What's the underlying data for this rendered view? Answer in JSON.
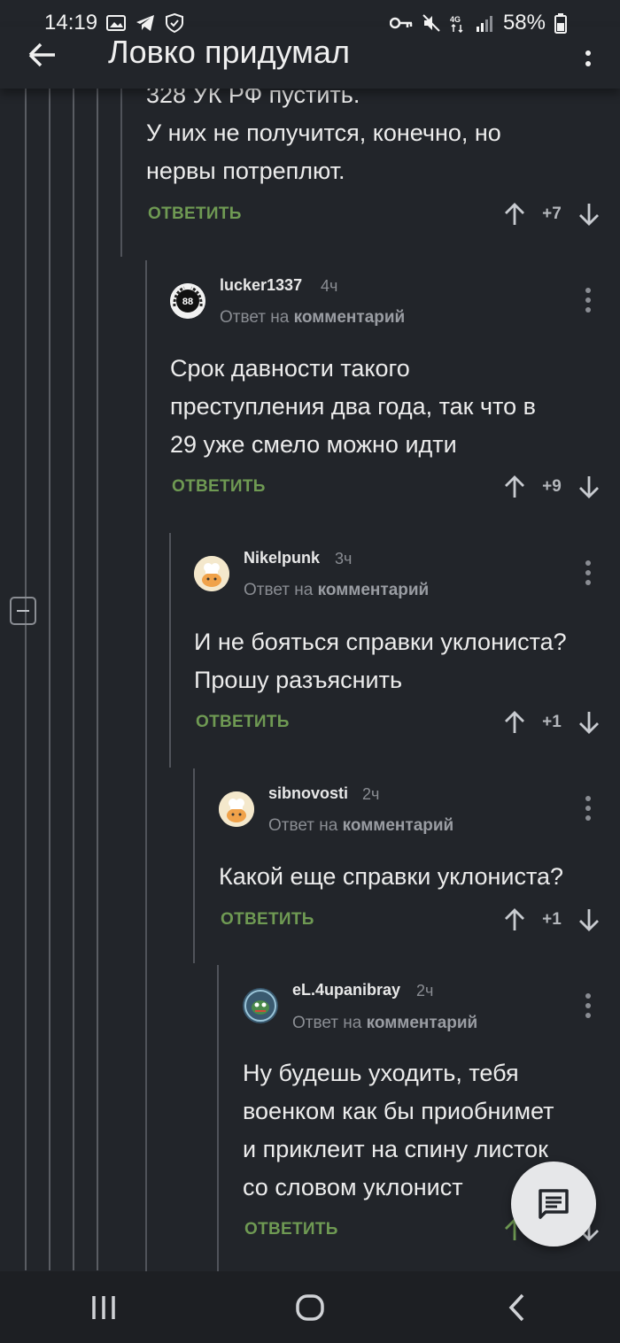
{
  "status_bar": {
    "time": "14:19",
    "battery": "58%",
    "icons_left": [
      "gallery-icon",
      "telegram-icon",
      "vpn-shield-icon"
    ],
    "icons_right": [
      "key-icon",
      "mute-icon",
      "4g-icon",
      "signal-icon",
      "battery-icon"
    ]
  },
  "app_bar": {
    "title": "Ловко придумал"
  },
  "comments": [
    {
      "text_lines": [
        "328 УК РФ пустить.",
        "У них не получится, конечно, но",
        "нервы потреплют."
      ],
      "reply_label": "ОТВЕТИТЬ",
      "rating": "+7"
    },
    {
      "username": "lucker1337",
      "time": "4ч",
      "reply_prefix": "Ответ на",
      "reply_target": "комментарий",
      "avatar_text": "88",
      "text_lines": [
        "Срок давности такого",
        "преступления два года, так что в",
        "29 уже смело можно идти"
      ],
      "reply_label": "ОТВЕТИТЬ",
      "rating": "+9"
    },
    {
      "username": "Nikelpunk",
      "time": "3ч",
      "reply_prefix": "Ответ на",
      "reply_target": "комментарий",
      "text_lines": [
        "И не бояться справки уклониста?",
        "Прошу разъяснить"
      ],
      "reply_label": "ОТВЕТИТЬ",
      "rating": "+1"
    },
    {
      "username": "sibnovosti",
      "time": "2ч",
      "reply_prefix": "Ответ на",
      "reply_target": "комментарий",
      "text_lines": [
        "Какой еще справки уклониста?"
      ],
      "reply_label": "ОТВЕТИТЬ",
      "rating": "+1"
    },
    {
      "username": "eL.4upanibray",
      "time": "2ч",
      "reply_prefix": "Ответ на",
      "reply_target": "комментарий",
      "text_lines": [
        "Ну будешь уходить, тебя",
        "военком как бы приобнимет",
        "и приклеит на спину листок",
        "со словом уклонист"
      ],
      "reply_label": "ОТВЕТИТЬ"
    }
  ],
  "colors": {
    "background": "#22252a",
    "reply_green": "#6f9a53",
    "muted_text": "#8a8d93",
    "fab": "#e6e7e9"
  }
}
